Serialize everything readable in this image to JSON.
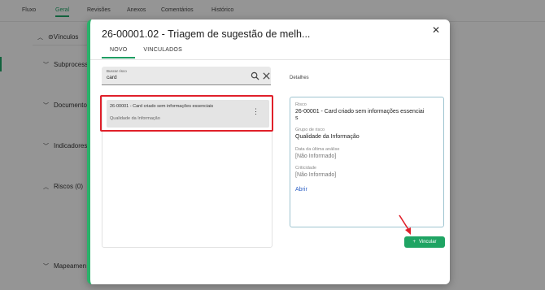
{
  "background": {
    "tabs": [
      "Fluxo",
      "Geral",
      "Revisões",
      "Anexos",
      "Comentários",
      "Histórico"
    ],
    "active_tab": "Geral",
    "sections": {
      "vinculos": "Vínculos",
      "subprocessos": "Subprocesso",
      "documentos": "Documento",
      "indicadores": "Indicadores",
      "riscos": "Riscos (0)",
      "mapeamento": "Mapeamen"
    }
  },
  "modal": {
    "title": "26-00001.02 - Triagem de sugestão de melh...",
    "tabs": [
      "NOVO",
      "VINCULADOS"
    ],
    "active_tab": "NOVO",
    "search": {
      "label": "Buscar risco",
      "value": "card"
    },
    "results": [
      {
        "title": "26-00001 - Card criado sem informações essenciais",
        "subtitle": "Qualidade da Informação"
      }
    ],
    "details": {
      "heading": "Detalhes",
      "fields": {
        "risco_label": "Risco",
        "risco_value_line1": "26-00001 - Card criado sem informações essenciai",
        "risco_value_line2": "s",
        "grupo_label": "Grupo de risco",
        "grupo_value": "Qualidade da Informação",
        "data_label": "Data da última análise",
        "data_value": "[Não Informado]",
        "criticidade_label": "Criticidade",
        "criticidade_value": "[Não Informado]",
        "abrir_link": "Abrir"
      }
    },
    "vincular_label": "Vincular"
  },
  "colors": {
    "accent_green": "#1fa463",
    "highlight_red": "#e0202a",
    "link_blue": "#2b5fc5"
  }
}
